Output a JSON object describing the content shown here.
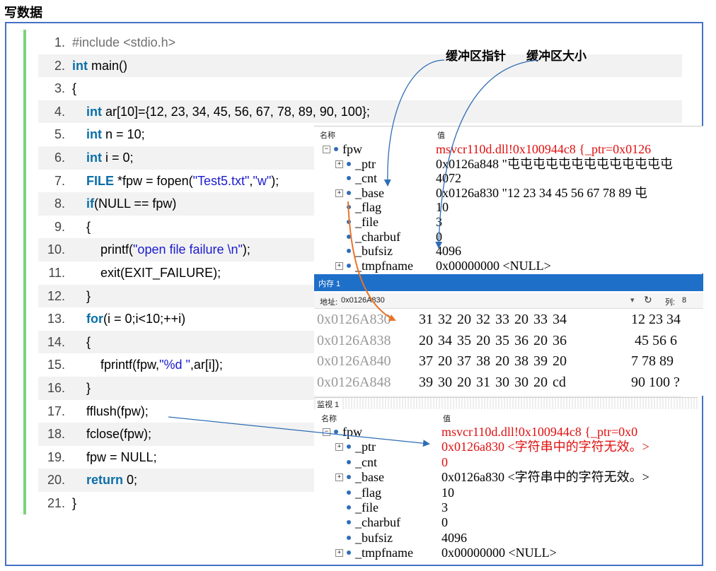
{
  "page_title": "写数据",
  "code_lines": [
    {
      "num": "1.",
      "tokens": [
        {
          "t": "#include <stdio.h>",
          "c": "pp"
        }
      ]
    },
    {
      "num": "2.",
      "tokens": [
        {
          "t": "int",
          "c": "kw"
        },
        {
          "t": " main()",
          "c": ""
        }
      ]
    },
    {
      "num": "3.",
      "tokens": [
        {
          "t": "{",
          "c": ""
        }
      ]
    },
    {
      "num": "4.",
      "tokens": [
        {
          "t": "    ",
          "c": ""
        },
        {
          "t": "int",
          "c": "kw"
        },
        {
          "t": " ar[10]={12, 23, 34, 45, 56, 67, 78, 89, 90, 100};",
          "c": ""
        }
      ]
    },
    {
      "num": "5.",
      "tokens": [
        {
          "t": "    ",
          "c": ""
        },
        {
          "t": "int",
          "c": "kw"
        },
        {
          "t": " n = 10;",
          "c": ""
        }
      ]
    },
    {
      "num": "6.",
      "tokens": [
        {
          "t": "    ",
          "c": ""
        },
        {
          "t": "int",
          "c": "kw"
        },
        {
          "t": " i = 0;",
          "c": ""
        }
      ]
    },
    {
      "num": "7.",
      "tokens": [
        {
          "t": "    ",
          "c": ""
        },
        {
          "t": "FILE",
          "c": "kw"
        },
        {
          "t": " *fpw = fopen(",
          "c": ""
        },
        {
          "t": "\"Test5.txt\"",
          "c": "str"
        },
        {
          "t": ",",
          "c": ""
        },
        {
          "t": "\"w\"",
          "c": "str"
        },
        {
          "t": ");",
          "c": ""
        }
      ]
    },
    {
      "num": "8.",
      "tokens": [
        {
          "t": "    ",
          "c": ""
        },
        {
          "t": "if",
          "c": "kw"
        },
        {
          "t": "(NULL == fpw)",
          "c": ""
        }
      ]
    },
    {
      "num": "9.",
      "tokens": [
        {
          "t": "    {",
          "c": ""
        }
      ]
    },
    {
      "num": "10.",
      "tokens": [
        {
          "t": "        printf(",
          "c": ""
        },
        {
          "t": "\"open file failure \\n\"",
          "c": "str"
        },
        {
          "t": ");",
          "c": ""
        }
      ]
    },
    {
      "num": "11.",
      "tokens": [
        {
          "t": "        exit(EXIT_FAILURE);",
          "c": ""
        }
      ]
    },
    {
      "num": "12.",
      "tokens": [
        {
          "t": "    }",
          "c": ""
        }
      ]
    },
    {
      "num": "13.",
      "tokens": [
        {
          "t": "    ",
          "c": ""
        },
        {
          "t": "for",
          "c": "kw"
        },
        {
          "t": "(i = 0;i<10;++i)",
          "c": ""
        }
      ]
    },
    {
      "num": "14.",
      "tokens": [
        {
          "t": "    {",
          "c": ""
        }
      ]
    },
    {
      "num": "15.",
      "tokens": [
        {
          "t": "        fprintf(fpw,",
          "c": ""
        },
        {
          "t": "\"%d \"",
          "c": "str"
        },
        {
          "t": ",ar[i]);",
          "c": ""
        }
      ]
    },
    {
      "num": "16.",
      "tokens": [
        {
          "t": "    }",
          "c": ""
        }
      ]
    },
    {
      "num": "17.",
      "tokens": [
        {
          "t": "    fflush(fpw);",
          "c": ""
        }
      ]
    },
    {
      "num": "18.",
      "tokens": [
        {
          "t": "    fclose(fpw);",
          "c": ""
        }
      ]
    },
    {
      "num": "19.",
      "tokens": [
        {
          "t": "    fpw = NULL;",
          "c": ""
        }
      ]
    },
    {
      "num": "20.",
      "tokens": [
        {
          "t": "    ",
          "c": ""
        },
        {
          "t": "return",
          "c": "kw"
        },
        {
          "t": " 0;",
          "c": ""
        }
      ]
    },
    {
      "num": "21.",
      "tokens": [
        {
          "t": "}",
          "c": ""
        }
      ]
    }
  ],
  "annotations": {
    "buf_ptr": "缓冲区指针",
    "buf_size": "缓冲区大小"
  },
  "watch1": {
    "col_name": "名称",
    "col_value": "值",
    "rows": [
      {
        "exp": "⊟",
        "name": "fpw",
        "value": "msvcr110d.dll!0x100944c8 {_ptr=0x0126",
        "red": true,
        "indent": 0
      },
      {
        "exp": "⊞",
        "name": "_ptr",
        "value": "0x0126a848 \"屯屯屯屯屯屯屯屯屯屯屯屯屯",
        "red": false,
        "indent": 1
      },
      {
        "exp": "",
        "name": "_cnt",
        "value": "4072",
        "red": false,
        "indent": 1
      },
      {
        "exp": "⊞",
        "name": "_base",
        "value": "0x0126a830 \"12 23 34 45 56 67 78 89 屯",
        "red": false,
        "indent": 1
      },
      {
        "exp": "",
        "name": "_flag",
        "value": "10",
        "red": false,
        "indent": 1
      },
      {
        "exp": "",
        "name": "_file",
        "value": "3",
        "red": false,
        "indent": 1
      },
      {
        "exp": "",
        "name": "_charbuf",
        "value": "0",
        "red": false,
        "indent": 1
      },
      {
        "exp": "",
        "name": "_bufsiz",
        "value": "4096",
        "red": false,
        "indent": 1
      },
      {
        "exp": "⊞",
        "name": "_tmpfname",
        "value": "0x00000000 <NULL>",
        "red": false,
        "indent": 1
      }
    ]
  },
  "memory": {
    "title": "内存 1",
    "addr_label": "地址:",
    "addr_value": "0x0126A830",
    "col_label": "列:",
    "col_value": "8",
    "rows": [
      {
        "addr": "0x0126A830",
        "bytes": "31 32 20 32 33 20 33 34",
        "ascii": "12 23 34"
      },
      {
        "addr": "0x0126A838",
        "bytes": "20 34 35 20 35 36 20 36",
        "ascii": " 45 56 6"
      },
      {
        "addr": "0x0126A840",
        "bytes": "37 20 37 38 20 38 39 20",
        "ascii": "7 78 89 "
      },
      {
        "addr": "0x0126A848",
        "bytes": "39 30 20 31 30 30 20 cd",
        "ascii": "90 100 ?"
      }
    ]
  },
  "watch2": {
    "title": "监视 1",
    "col_name": "名称",
    "col_value": "值",
    "rows": [
      {
        "exp": "⊟",
        "name": "fpw",
        "value": "msvcr110d.dll!0x100944c8 {_ptr=0x0",
        "red": true,
        "indent": 0
      },
      {
        "exp": "⊞",
        "name": "_ptr",
        "value": "0x0126a830 <字符串中的字符无效。>",
        "red": true,
        "indent": 1
      },
      {
        "exp": "",
        "name": "_cnt",
        "value": "0",
        "red": true,
        "indent": 1
      },
      {
        "exp": "⊞",
        "name": "_base",
        "value": "0x0126a830 <字符串中的字符无效。>",
        "red": false,
        "indent": 1
      },
      {
        "exp": "",
        "name": "_flag",
        "value": "10",
        "red": false,
        "indent": 1
      },
      {
        "exp": "",
        "name": "_file",
        "value": "3",
        "red": false,
        "indent": 1
      },
      {
        "exp": "",
        "name": "_charbuf",
        "value": "0",
        "red": false,
        "indent": 1
      },
      {
        "exp": "",
        "name": "_bufsiz",
        "value": "4096",
        "red": false,
        "indent": 1
      },
      {
        "exp": "⊞",
        "name": "_tmpfname",
        "value": "0x00000000 <NULL>",
        "red": false,
        "indent": 1
      }
    ]
  },
  "colors": {
    "frame": "#4472c4",
    "keyword": "#0b6fa8",
    "string": "#1a1ad0",
    "watch_red": "#e01010",
    "arrow_blue": "#2e6db5",
    "arrow_orange": "#e8742a",
    "memory_header": "#1e6fc8"
  }
}
